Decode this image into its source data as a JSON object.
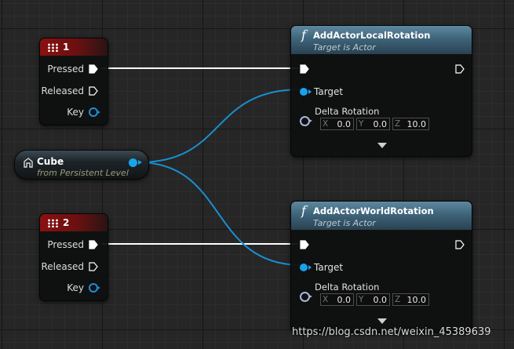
{
  "event_nodes": [
    {
      "key_label": "1",
      "pins": {
        "pressed": "Pressed",
        "released": "Released",
        "key": "Key"
      }
    },
    {
      "key_label": "2",
      "pins": {
        "pressed": "Pressed",
        "released": "Released",
        "key": "Key"
      }
    }
  ],
  "variable_node": {
    "name": "Cube",
    "subtitle": "from Persistent Level"
  },
  "function_nodes": [
    {
      "icon": "f",
      "title": "AddActorLocalRotation",
      "subtitle": "Target is Actor",
      "target_label": "Target",
      "delta_label": "Delta Rotation",
      "fields": {
        "x_axis": "X",
        "x": "0.0",
        "y_axis": "Y",
        "y": "0.0",
        "z_axis": "Z",
        "z": "10.0"
      }
    },
    {
      "icon": "f",
      "title": "AddActorWorldRotation",
      "subtitle": "Target is Actor",
      "target_label": "Target",
      "delta_label": "Delta Rotation",
      "fields": {
        "x_axis": "X",
        "x": "0.0",
        "y_axis": "Y",
        "y": "0.0",
        "z_axis": "Z",
        "z": "10.0"
      }
    }
  ],
  "colors": {
    "exec_wire": "#ffffff",
    "object_wire": "#1aa3ea",
    "event_header": "#8b1010",
    "function_header": "#4a7088",
    "rotator_pin": "#a7b9d8"
  },
  "watermark": "https://blog.csdn.net/weixin_45389639"
}
